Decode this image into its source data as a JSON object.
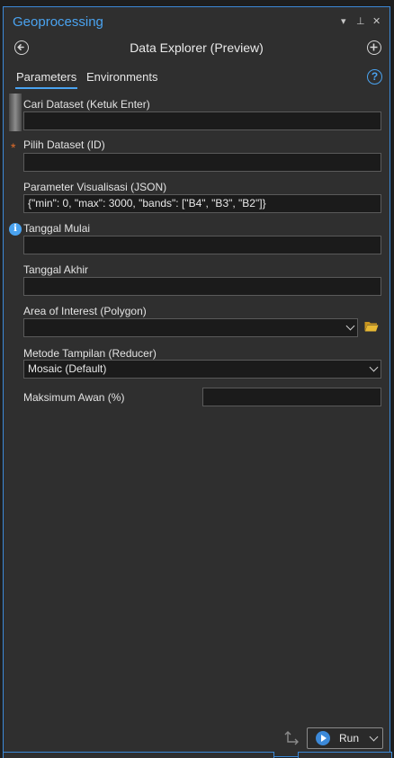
{
  "window": {
    "title": "Geoprocessing",
    "ctl_dropdown": "▾",
    "ctl_pin": "⊥",
    "ctl_close": "✕"
  },
  "header": {
    "title": "Data Explorer (Preview)"
  },
  "tabs": [
    {
      "label": "Parameters"
    },
    {
      "label": "Environments"
    }
  ],
  "help_label": "?",
  "fields": {
    "search_dataset": {
      "label": "Cari Dataset (Ketuk Enter)",
      "value": ""
    },
    "dataset_id": {
      "label": "Pilih Dataset (ID)",
      "value": ""
    },
    "vis_params": {
      "label": "Parameter Visualisasi (JSON)",
      "value": "{\"min\": 0, \"max\": 3000, \"bands\": [\"B4\", \"B3\", \"B2\"]}"
    },
    "start_date": {
      "label": "Tanggal Mulai",
      "value": ""
    },
    "end_date": {
      "label": "Tanggal Akhir",
      "value": ""
    },
    "aoi": {
      "label": "Area of Interest (Polygon)",
      "value": ""
    },
    "reducer": {
      "label": "Metode Tampilan (Reducer)",
      "value": "Mosaic (Default)"
    },
    "max_cloud": {
      "label": "Maksimum Awan (%)",
      "value": ""
    }
  },
  "required_marker": "*",
  "info_marker": "i",
  "run_button": {
    "label": "Run"
  },
  "colors": {
    "accent": "#4aa3f0",
    "panel": "#2f2f2f",
    "input_bg": "#1b1b1b",
    "required": "#e06c2a",
    "folder": "#e8b934"
  }
}
